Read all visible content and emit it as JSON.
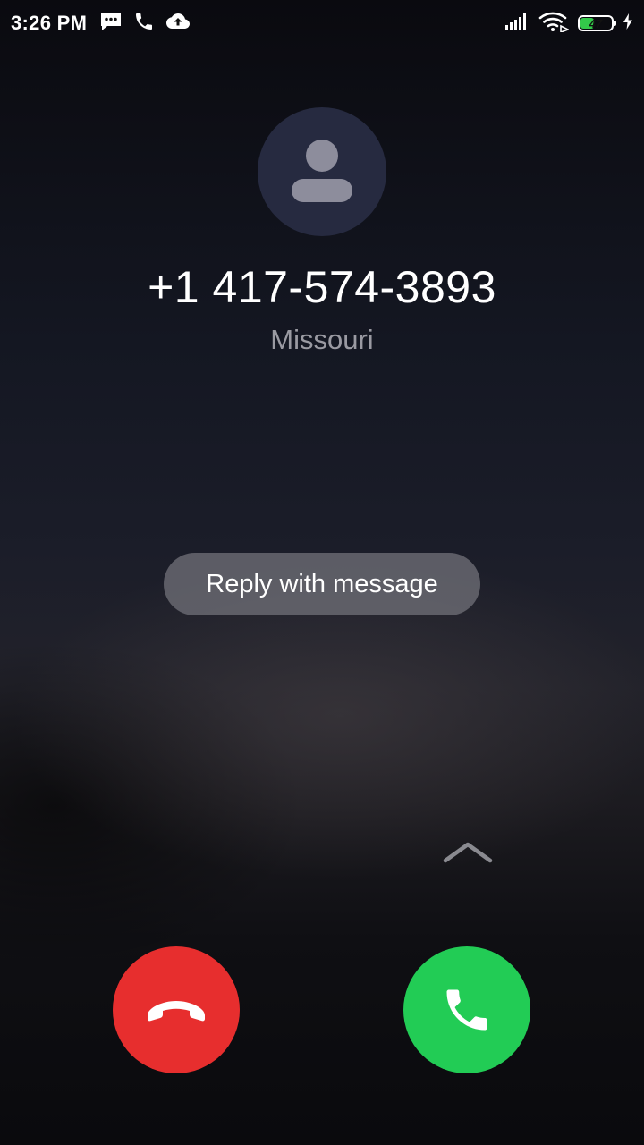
{
  "status_bar": {
    "time": "3:26 PM",
    "left_icons": [
      "message-icon",
      "phone-icon",
      "cloud-upload-icon"
    ],
    "right_icons": [
      "signal-icon",
      "wifi-icon",
      "battery-icon",
      "charging-icon"
    ],
    "battery_level": "47",
    "battery_fraction": 0.47
  },
  "caller": {
    "avatar_icon": "person-icon",
    "number": "+1 417-574-3893",
    "location": "Missouri"
  },
  "actions": {
    "reply_label": "Reply with message",
    "swipe_hint_icon": "chevron-up-icon",
    "decline_icon": "hang-up-icon",
    "answer_icon": "phone-answer-icon"
  },
  "colors": {
    "decline": "#e72e2e",
    "answer": "#22cc55",
    "avatar_bg": "#262a40",
    "battery_fill": "#33c94a"
  }
}
